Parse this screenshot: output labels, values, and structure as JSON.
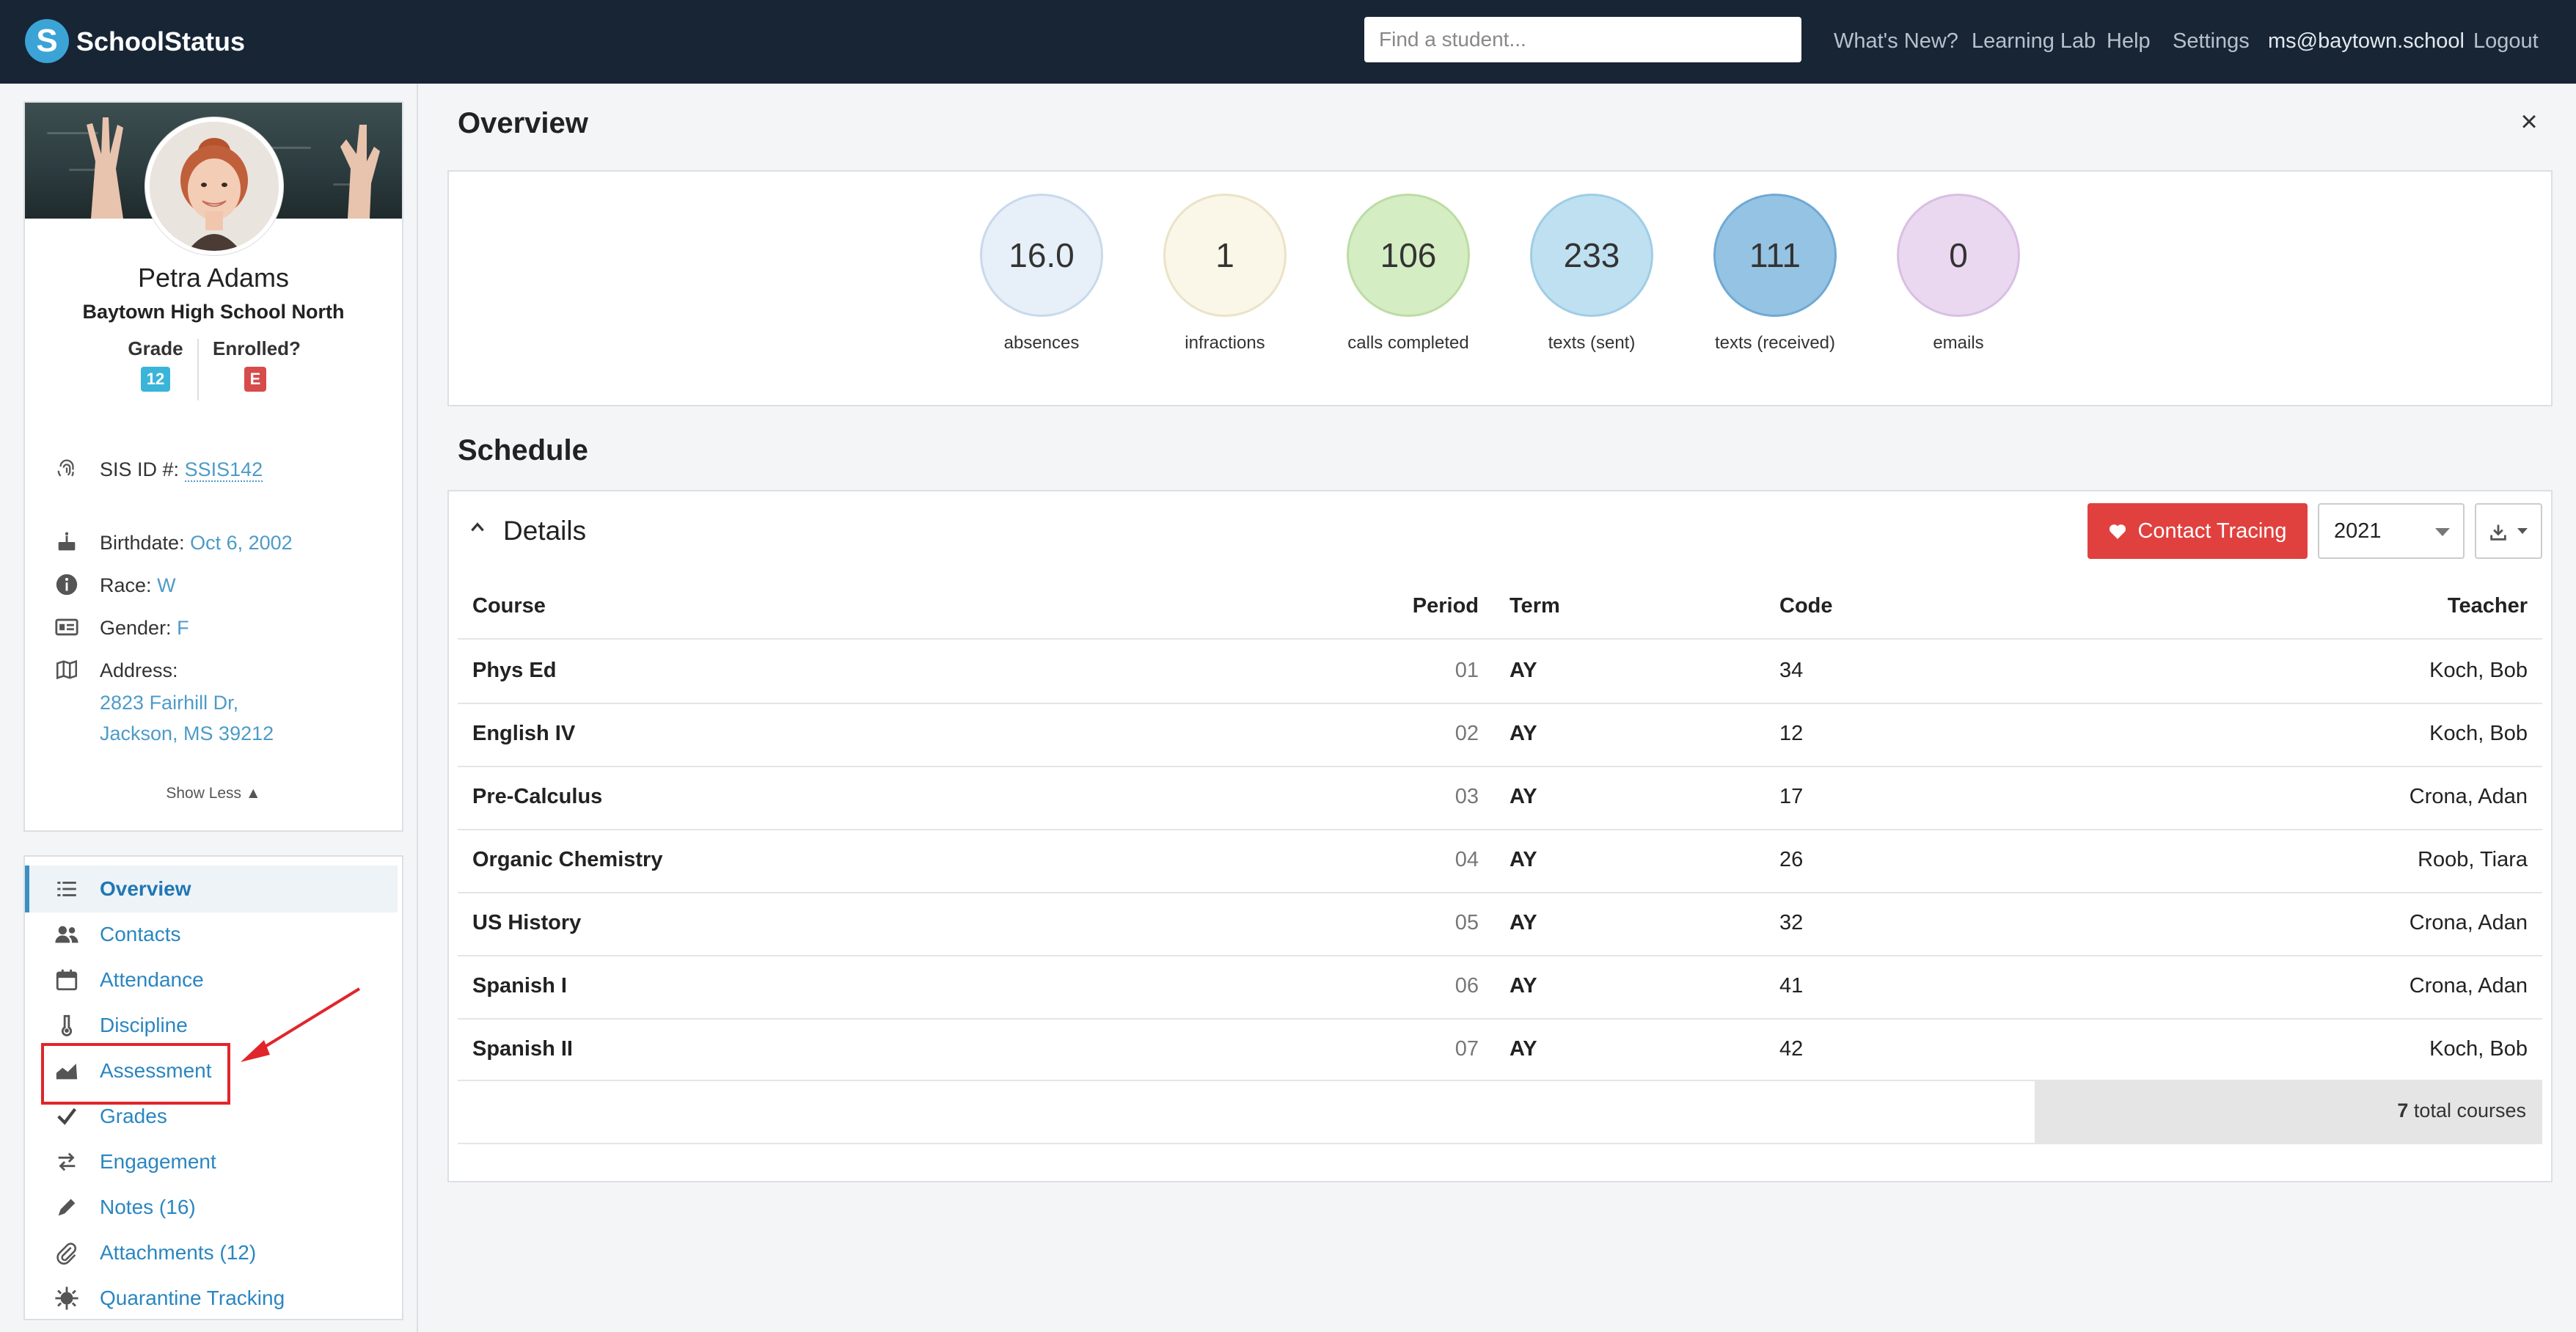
{
  "header": {
    "app_name": "SchoolStatus",
    "logo_letter": "S",
    "search_placeholder": "Find a student...",
    "nav": [
      "What's New?",
      "Learning Lab",
      "Help",
      "Settings"
    ],
    "user_email": "ms@baytown.school",
    "logout": "Logout"
  },
  "student": {
    "name": "Petra Adams",
    "school": "Baytown High School North",
    "grade_label": "Grade",
    "grade": "12",
    "enrolled_label": "Enrolled?",
    "enrolled": "E",
    "sis_label": "SIS ID #:",
    "sis_id": "SSIS142",
    "birthdate_label": "Birthdate:",
    "birthdate": "Oct 6, 2002",
    "race_label": "Race:",
    "race": "W",
    "gender_label": "Gender:",
    "gender": "F",
    "address_label": "Address:",
    "address_line1": "2823 Fairhill Dr,",
    "address_line2": "Jackson, MS 39212",
    "show_less": "Show Less ▲"
  },
  "sidebar": {
    "items": [
      {
        "label": "Overview",
        "icon": "list-icon"
      },
      {
        "label": "Contacts",
        "icon": "users-icon"
      },
      {
        "label": "Attendance",
        "icon": "calendar-icon"
      },
      {
        "label": "Discipline",
        "icon": "thermometer-icon"
      },
      {
        "label": "Assessment",
        "icon": "area-chart-icon"
      },
      {
        "label": "Grades",
        "icon": "check-icon"
      },
      {
        "label": "Engagement",
        "icon": "exchange-icon"
      },
      {
        "label": "Notes (16)",
        "icon": "pencil-icon"
      },
      {
        "label": "Attachments (12)",
        "icon": "paperclip-icon"
      },
      {
        "label": "Quarantine Tracking",
        "icon": "virus-icon"
      }
    ],
    "active": "Overview"
  },
  "overview": {
    "title": "Overview",
    "close": "×",
    "stats": [
      {
        "value": "16.0",
        "label": "absences",
        "fill": "#e7eff8",
        "border": "#c9d9ec"
      },
      {
        "value": "1",
        "label": "infractions",
        "fill": "#faf6e8",
        "border": "#ebe3c6"
      },
      {
        "value": "106",
        "label": "calls completed",
        "fill": "#d5edc2",
        "border": "#bddca4"
      },
      {
        "value": "233",
        "label": "texts (sent)",
        "fill": "#bfe0f0",
        "border": "#9fcde6"
      },
      {
        "value": "111",
        "label": "texts (received)",
        "fill": "#95c3e3",
        "border": "#6fa9d4"
      },
      {
        "value": "0",
        "label": "emails",
        "fill": "#ead8f0",
        "border": "#d9bfe3"
      }
    ]
  },
  "schedule": {
    "title": "Schedule",
    "details": "Details",
    "contact_tracing": "Contact Tracing",
    "year": "2021",
    "columns": {
      "course": "Course",
      "period": "Period",
      "term": "Term",
      "code": "Code",
      "teacher": "Teacher"
    },
    "rows": [
      {
        "course": "Phys Ed",
        "period": "01",
        "term": "AY",
        "code": "34",
        "teacher": "Koch, Bob"
      },
      {
        "course": "English IV",
        "period": "02",
        "term": "AY",
        "code": "12",
        "teacher": "Koch, Bob"
      },
      {
        "course": "Pre-Calculus",
        "period": "03",
        "term": "AY",
        "code": "17",
        "teacher": "Crona, Adan"
      },
      {
        "course": "Organic Chemistry",
        "period": "04",
        "term": "AY",
        "code": "26",
        "teacher": "Roob, Tiara"
      },
      {
        "course": "US History",
        "period": "05",
        "term": "AY",
        "code": "32",
        "teacher": "Crona, Adan"
      },
      {
        "course": "Spanish I",
        "period": "06",
        "term": "AY",
        "code": "41",
        "teacher": "Crona, Adan"
      },
      {
        "course": "Spanish II",
        "period": "07",
        "term": "AY",
        "code": "42",
        "teacher": "Koch, Bob"
      }
    ],
    "total_count": "7",
    "total_suffix": "total courses"
  },
  "colors": {
    "topbar": "#172535",
    "accent": "#2a86c1",
    "danger": "#e0413f",
    "annotation": "#e0262b"
  }
}
